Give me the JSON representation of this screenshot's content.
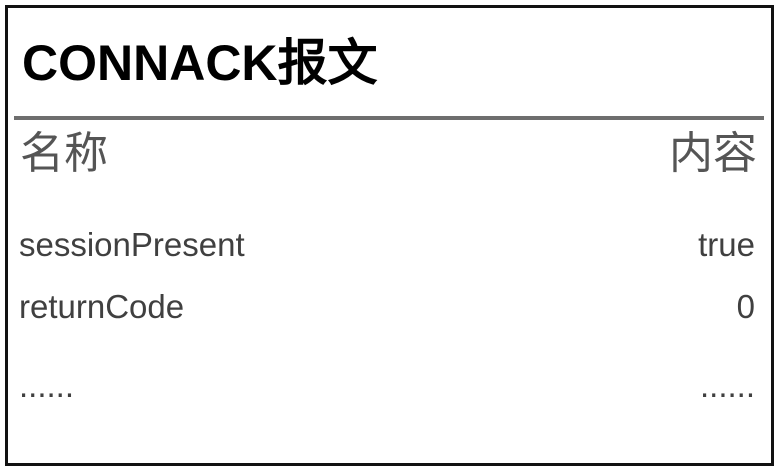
{
  "title": "CONNACK报文",
  "headers": {
    "name": "名称",
    "value": "内容"
  },
  "rows": [
    {
      "name": "sessionPresent",
      "value": "true"
    },
    {
      "name": "returnCode",
      "value": "0"
    },
    {
      "name": "......",
      "value": "......"
    }
  ],
  "colors": {
    "border": "#111111",
    "divider": "#6e6e6e",
    "header_text": "#555555",
    "row_text": "#404040"
  }
}
